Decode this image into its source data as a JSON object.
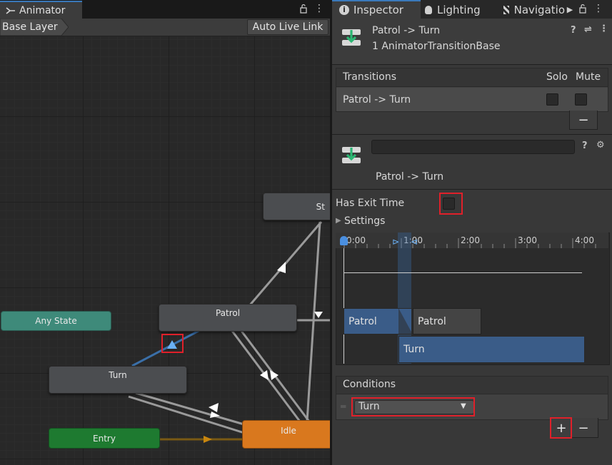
{
  "animator": {
    "tab_label": "Animator",
    "breadcrumb": "Base Layer",
    "auto_live_link": "Auto Live Link",
    "nodes": {
      "start_partial": "St",
      "any_state": "Any State",
      "patrol": "Patrol",
      "turn": "Turn",
      "entry": "Entry",
      "idle": "Idle"
    }
  },
  "inspector": {
    "tabs": [
      "Inspector",
      "Lighting",
      "Navigatio"
    ],
    "header": {
      "title": "Patrol -> Turn",
      "subtitle": "1 AnimatorTransitionBase"
    },
    "transitions": {
      "header": "Transitions",
      "solo": "Solo",
      "mute": "Mute",
      "row": "Patrol -> Turn",
      "remove": "−"
    },
    "transition_name_value": "",
    "transition_title": "Patrol -> Turn",
    "has_exit_time": "Has Exit Time",
    "settings": "Settings",
    "timeline": {
      "ticks": [
        "0:00",
        "1:00",
        "2:00",
        "3:00",
        "4:00"
      ],
      "bars": {
        "source_a": "Patrol",
        "source_b": "Patrol",
        "destination": "Turn"
      }
    },
    "conditions": {
      "header": "Conditions",
      "selected": "Turn",
      "add": "+",
      "remove": "−"
    }
  },
  "colors": {
    "accent_blue": "#3a79bb",
    "any_state": "#3e8a7a",
    "entry": "#1e7a30",
    "idle": "#d9781e",
    "highlight_red": "#e0202a"
  }
}
